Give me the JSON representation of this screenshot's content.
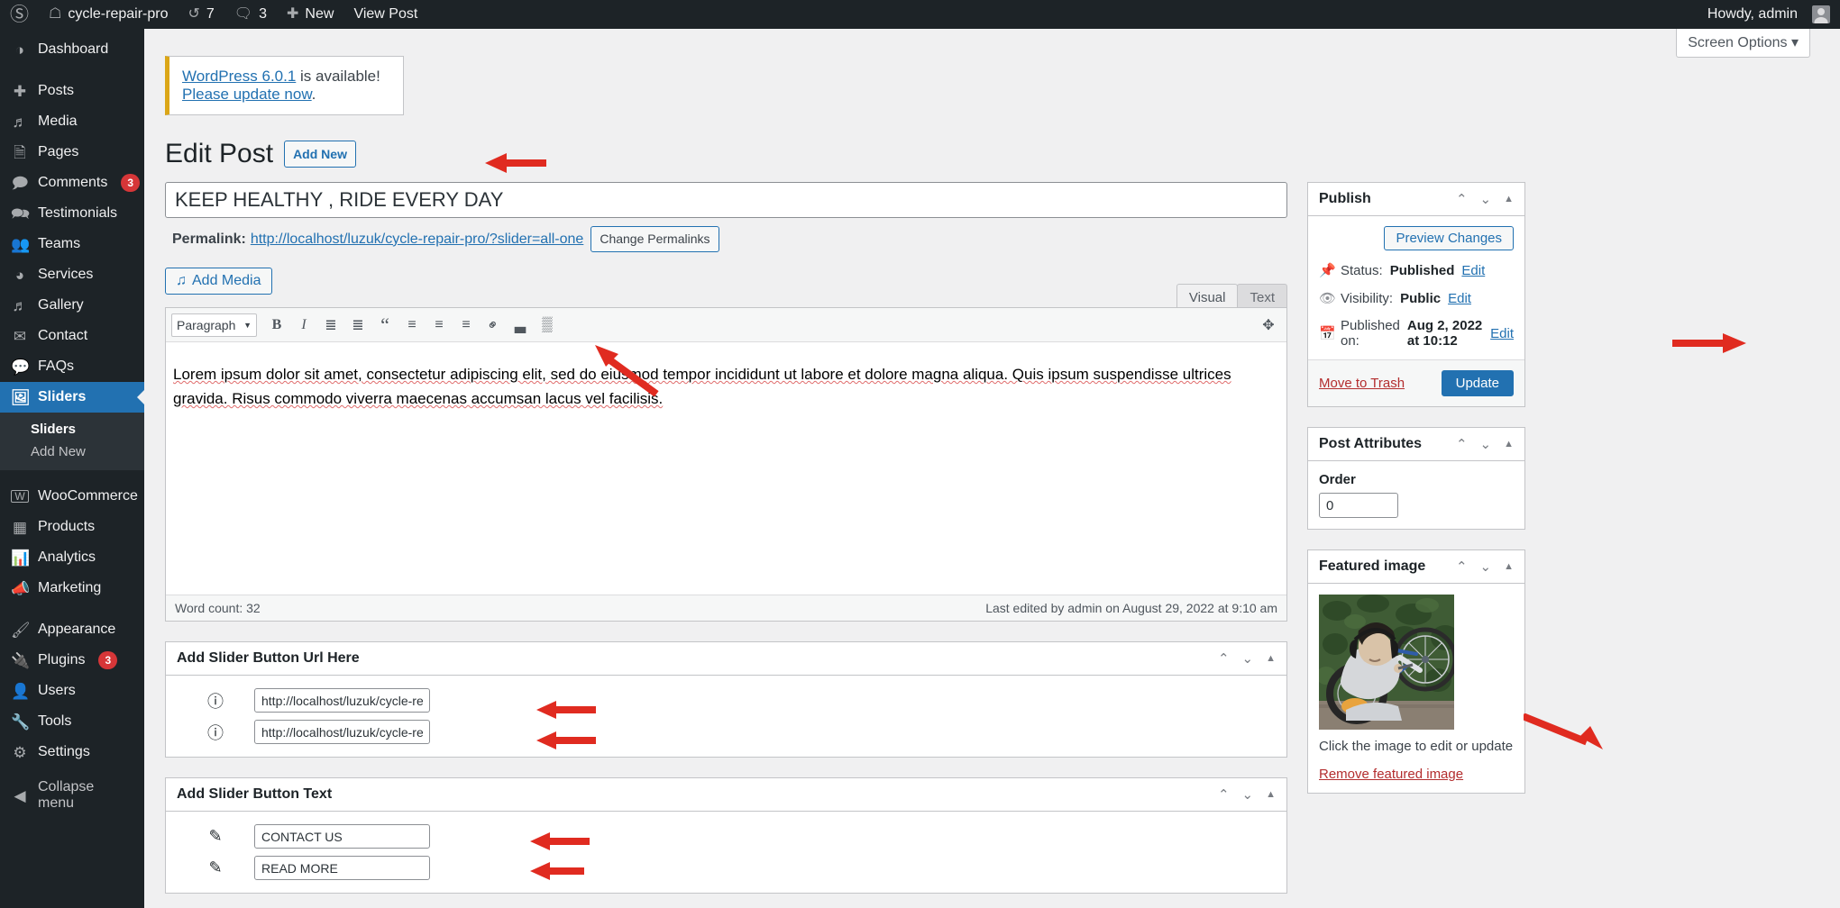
{
  "adminbar": {
    "site_name": "cycle-repair-pro",
    "updates_count": "7",
    "comments_count": "3",
    "new_label": "New",
    "view_post_label": "View Post",
    "howdy": "Howdy, admin"
  },
  "screen_options": {
    "label": "Screen Options"
  },
  "sidebar": {
    "items": [
      {
        "label": "Dashboard",
        "icon": "dashboard-icon",
        "glyph": "◔",
        "badge": ""
      },
      {
        "label": "Posts",
        "icon": "pin-icon",
        "glyph": "✐",
        "badge": "",
        "gap": true
      },
      {
        "label": "Media",
        "icon": "media-icon",
        "glyph": "♪",
        "badge": ""
      },
      {
        "label": "Pages",
        "icon": "pages-icon",
        "glyph": "❐",
        "badge": ""
      },
      {
        "label": "Comments",
        "icon": "comment-icon",
        "glyph": "⬛",
        "badge": "3"
      },
      {
        "label": "Testimonials",
        "icon": "testimonials-icon",
        "glyph": "⬛",
        "badge": ""
      },
      {
        "label": "Teams",
        "icon": "teams-icon",
        "glyph": "⚇",
        "badge": ""
      },
      {
        "label": "Services",
        "icon": "services-icon",
        "glyph": "◔",
        "badge": ""
      },
      {
        "label": "Gallery",
        "icon": "gallery-icon",
        "glyph": "♪",
        "badge": ""
      },
      {
        "label": "Contact",
        "icon": "mail-icon",
        "glyph": "✉",
        "badge": ""
      },
      {
        "label": "FAQs",
        "icon": "faq-icon",
        "glyph": "●",
        "badge": ""
      },
      {
        "label": "Sliders",
        "icon": "sliders-icon",
        "glyph": "❐",
        "badge": "",
        "current": true
      }
    ],
    "submenu": [
      {
        "label": "Sliders",
        "current": true
      },
      {
        "label": "Add New",
        "current": false
      }
    ],
    "items2": [
      {
        "label": "WooCommerce",
        "icon": "woocommerce-icon",
        "glyph": "W",
        "badge": "",
        "gap": true
      },
      {
        "label": "Products",
        "icon": "products-icon",
        "glyph": "▤",
        "badge": ""
      },
      {
        "label": "Analytics",
        "icon": "analytics-icon",
        "glyph": "█",
        "badge": ""
      },
      {
        "label": "Marketing",
        "icon": "megaphone-icon",
        "glyph": "✉",
        "badge": ""
      },
      {
        "label": "Appearance",
        "icon": "brush-icon",
        "glyph": "✐",
        "badge": "",
        "gap": true
      },
      {
        "label": "Plugins",
        "icon": "plugins-icon",
        "glyph": "⚒",
        "badge": "3"
      },
      {
        "label": "Users",
        "icon": "users-icon",
        "glyph": "⚲",
        "badge": ""
      },
      {
        "label": "Tools",
        "icon": "tools-icon",
        "glyph": "⚒",
        "badge": ""
      },
      {
        "label": "Settings",
        "icon": "settings-icon",
        "glyph": "⚙",
        "badge": ""
      }
    ],
    "collapse": {
      "label": "Collapse menu",
      "glyph": "◀"
    }
  },
  "notice": {
    "link_version": "WordPress 6.0.1",
    "middle": " is available! ",
    "link_update": "Please update now",
    "period": "."
  },
  "page": {
    "title": "Edit Post",
    "add_new": "Add New"
  },
  "post": {
    "title_value": "KEEP HEALTHY , RIDE EVERY DAY",
    "permalink_label": "Permalink:",
    "permalink_url": "http://localhost/luzuk/cycle-repair-pro/?slider=all-one",
    "change_permalinks": "Change Permalinks"
  },
  "editor": {
    "add_media": "Add Media",
    "tab_visual": "Visual",
    "tab_text": "Text",
    "paragraph_select": "Paragraph",
    "toolbar_buttons": [
      {
        "name": "bold-icon",
        "glyph": "B"
      },
      {
        "name": "italic-icon",
        "glyph": "I"
      },
      {
        "name": "bulleted-list-icon",
        "glyph": "≣"
      },
      {
        "name": "numbered-list-icon",
        "glyph": "≣"
      },
      {
        "name": "blockquote-icon",
        "glyph": "“"
      },
      {
        "name": "align-left-icon",
        "glyph": "≡"
      },
      {
        "name": "align-center-icon",
        "glyph": "≡"
      },
      {
        "name": "align-right-icon",
        "glyph": "≡"
      },
      {
        "name": "insert-link-icon",
        "glyph": "⚭"
      },
      {
        "name": "read-more-icon",
        "glyph": "▃"
      },
      {
        "name": "toolbar-toggle-icon",
        "glyph": "▒"
      }
    ],
    "fullscreen_icon": "distraction-free-icon",
    "body_text": "Lorem ipsum dolor sit amet, consectetur adipiscing elit, sed do eiusmod tempor incididunt ut labore et dolore magna aliqua. Quis ipsum suspendisse ultrices gravida. Risus commodo viverra maecenas accumsan lacus vel facilisis.",
    "word_count": "Word count: 32",
    "last_edited": "Last edited by admin on August 29, 2022 at 9:10 am"
  },
  "metaboxes": [
    {
      "title": "Add Slider Button Url Here",
      "icon": "info-icon",
      "glyph": "ℹ",
      "fields": [
        {
          "value": "http://localhost/luzuk/cycle-repair-"
        },
        {
          "value": "http://localhost/luzuk/cycle-repair-"
        }
      ]
    },
    {
      "title": "Add Slider Button Text",
      "icon": "pencil-icon",
      "glyph": "✎",
      "fields": [
        {
          "value": "CONTACT US"
        },
        {
          "value": "READ MORE"
        }
      ]
    }
  ],
  "publish": {
    "title": "Publish",
    "preview_changes": "Preview Changes",
    "status_label": "Status:",
    "status_value": "Published",
    "status_edit": "Edit",
    "visibility_label": "Visibility:",
    "visibility_value": "Public",
    "visibility_edit": "Edit",
    "published_label": "Published on:",
    "published_value": "Aug 2, 2022 at 10:12",
    "published_edit": "Edit",
    "move_to_trash": "Move to Trash",
    "update_button": "Update"
  },
  "post_attributes": {
    "title": "Post Attributes",
    "order_label": "Order",
    "order_value": "0"
  },
  "featured_image": {
    "title": "Featured image",
    "caption": "Click the image to edit or update",
    "remove_link": "Remove featured image",
    "alt": "man repairing a bicycle wheel outdoors"
  },
  "colors": {
    "admin_dark": "#1d2327",
    "accent_blue": "#2271b1",
    "notice_yellow": "#dba617",
    "badge_red": "#d63638",
    "trash_red": "#b32d2e",
    "arrow_red": "#e02b20",
    "page_bg": "#f0f0f1"
  }
}
